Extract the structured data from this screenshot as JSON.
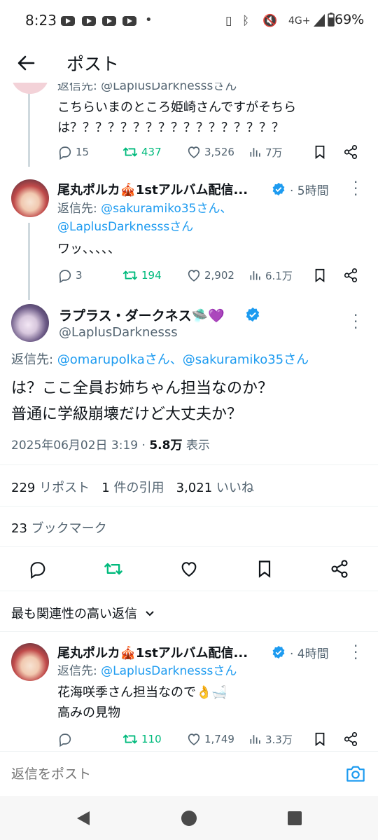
{
  "status": {
    "time": "8:23",
    "network": "4G+",
    "battery": "69%"
  },
  "header": {
    "title": "ポスト"
  },
  "tweet_prev": {
    "reply_to_partial": "返信先: @LaplusDarknesssさん",
    "text_line1": "こちらいまのところ姫崎さんですがそちら",
    "text_line2": "は？？？？？？？？？？？？？？？？？",
    "replies": "15",
    "reposts": "437",
    "likes": "3,526",
    "views": "7万"
  },
  "tweet_polka": {
    "name": "尾丸ポルカ🎪1stアルバム配信...",
    "time": "· 5時間",
    "reply_prefix": "返信先: ",
    "reply_user1": "@sakuramiko35さん、",
    "reply_user2": "@LaplusDarknesssさん",
    "text": "ワッ、、、、、",
    "replies": "3",
    "reposts": "194",
    "likes": "2,902",
    "views": "6.1万"
  },
  "main_tweet": {
    "name": "ラプラス・ダークネス",
    "name_emoji": "🛸💜",
    "handle": "@LaplusDarknesss",
    "reply_prefix": "返信先: ",
    "reply_users": "@omarupolkaさん、@sakuramiko35さん",
    "text_line1": "は？ここ全員お姉ちゃん担当なのか？",
    "text_line2": "普通に学級崩壊だけど大丈夫か？",
    "timestamp": "2025年06月02日 3:19 · ",
    "views_count": "5.8万",
    "views_label": " 表示",
    "reposts_count": "229",
    "reposts_label": " リポスト",
    "quotes_count": "1",
    "quotes_label": " 件の引用",
    "likes_count": "3,021",
    "likes_label": " いいね",
    "bookmarks_count": "23",
    "bookmarks_label": " ブックマーク"
  },
  "sort_label": "最も関連性の高い返信",
  "reply_polka": {
    "name": "尾丸ポルカ🎪1stアルバム配信...",
    "time": "· 4時間",
    "reply_prefix": "返信先: ",
    "reply_user": "@LaplusDarknesssさん",
    "text_line1": "花海咲季さん担当なので👌🛁",
    "text_line2": "高みの見物",
    "replies": "",
    "reposts": "110",
    "likes": "1,749",
    "views": "3.3万"
  },
  "reply_input": {
    "placeholder": "返信をポスト"
  },
  "colors": {
    "accent": "#1d9bf0",
    "repost_green": "#00ba7c",
    "text_gray": "#536471"
  }
}
